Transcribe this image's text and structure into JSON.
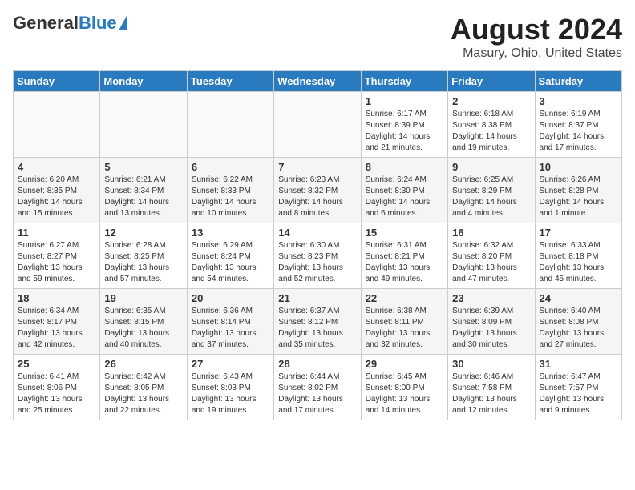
{
  "header": {
    "logo_general": "General",
    "logo_blue": "Blue",
    "title": "August 2024",
    "subtitle": "Masury, Ohio, United States"
  },
  "days_of_week": [
    "Sunday",
    "Monday",
    "Tuesday",
    "Wednesday",
    "Thursday",
    "Friday",
    "Saturday"
  ],
  "weeks": [
    [
      {
        "day": "",
        "info": ""
      },
      {
        "day": "",
        "info": ""
      },
      {
        "day": "",
        "info": ""
      },
      {
        "day": "",
        "info": ""
      },
      {
        "day": "1",
        "info": "Sunrise: 6:17 AM\nSunset: 8:39 PM\nDaylight: 14 hours\nand 21 minutes."
      },
      {
        "day": "2",
        "info": "Sunrise: 6:18 AM\nSunset: 8:38 PM\nDaylight: 14 hours\nand 19 minutes."
      },
      {
        "day": "3",
        "info": "Sunrise: 6:19 AM\nSunset: 8:37 PM\nDaylight: 14 hours\nand 17 minutes."
      }
    ],
    [
      {
        "day": "4",
        "info": "Sunrise: 6:20 AM\nSunset: 8:35 PM\nDaylight: 14 hours\nand 15 minutes."
      },
      {
        "day": "5",
        "info": "Sunrise: 6:21 AM\nSunset: 8:34 PM\nDaylight: 14 hours\nand 13 minutes."
      },
      {
        "day": "6",
        "info": "Sunrise: 6:22 AM\nSunset: 8:33 PM\nDaylight: 14 hours\nand 10 minutes."
      },
      {
        "day": "7",
        "info": "Sunrise: 6:23 AM\nSunset: 8:32 PM\nDaylight: 14 hours\nand 8 minutes."
      },
      {
        "day": "8",
        "info": "Sunrise: 6:24 AM\nSunset: 8:30 PM\nDaylight: 14 hours\nand 6 minutes."
      },
      {
        "day": "9",
        "info": "Sunrise: 6:25 AM\nSunset: 8:29 PM\nDaylight: 14 hours\nand 4 minutes."
      },
      {
        "day": "10",
        "info": "Sunrise: 6:26 AM\nSunset: 8:28 PM\nDaylight: 14 hours\nand 1 minute."
      }
    ],
    [
      {
        "day": "11",
        "info": "Sunrise: 6:27 AM\nSunset: 8:27 PM\nDaylight: 13 hours\nand 59 minutes."
      },
      {
        "day": "12",
        "info": "Sunrise: 6:28 AM\nSunset: 8:25 PM\nDaylight: 13 hours\nand 57 minutes."
      },
      {
        "day": "13",
        "info": "Sunrise: 6:29 AM\nSunset: 8:24 PM\nDaylight: 13 hours\nand 54 minutes."
      },
      {
        "day": "14",
        "info": "Sunrise: 6:30 AM\nSunset: 8:23 PM\nDaylight: 13 hours\nand 52 minutes."
      },
      {
        "day": "15",
        "info": "Sunrise: 6:31 AM\nSunset: 8:21 PM\nDaylight: 13 hours\nand 49 minutes."
      },
      {
        "day": "16",
        "info": "Sunrise: 6:32 AM\nSunset: 8:20 PM\nDaylight: 13 hours\nand 47 minutes."
      },
      {
        "day": "17",
        "info": "Sunrise: 6:33 AM\nSunset: 8:18 PM\nDaylight: 13 hours\nand 45 minutes."
      }
    ],
    [
      {
        "day": "18",
        "info": "Sunrise: 6:34 AM\nSunset: 8:17 PM\nDaylight: 13 hours\nand 42 minutes."
      },
      {
        "day": "19",
        "info": "Sunrise: 6:35 AM\nSunset: 8:15 PM\nDaylight: 13 hours\nand 40 minutes."
      },
      {
        "day": "20",
        "info": "Sunrise: 6:36 AM\nSunset: 8:14 PM\nDaylight: 13 hours\nand 37 minutes."
      },
      {
        "day": "21",
        "info": "Sunrise: 6:37 AM\nSunset: 8:12 PM\nDaylight: 13 hours\nand 35 minutes."
      },
      {
        "day": "22",
        "info": "Sunrise: 6:38 AM\nSunset: 8:11 PM\nDaylight: 13 hours\nand 32 minutes."
      },
      {
        "day": "23",
        "info": "Sunrise: 6:39 AM\nSunset: 8:09 PM\nDaylight: 13 hours\nand 30 minutes."
      },
      {
        "day": "24",
        "info": "Sunrise: 6:40 AM\nSunset: 8:08 PM\nDaylight: 13 hours\nand 27 minutes."
      }
    ],
    [
      {
        "day": "25",
        "info": "Sunrise: 6:41 AM\nSunset: 8:06 PM\nDaylight: 13 hours\nand 25 minutes."
      },
      {
        "day": "26",
        "info": "Sunrise: 6:42 AM\nSunset: 8:05 PM\nDaylight: 13 hours\nand 22 minutes."
      },
      {
        "day": "27",
        "info": "Sunrise: 6:43 AM\nSunset: 8:03 PM\nDaylight: 13 hours\nand 19 minutes."
      },
      {
        "day": "28",
        "info": "Sunrise: 6:44 AM\nSunset: 8:02 PM\nDaylight: 13 hours\nand 17 minutes."
      },
      {
        "day": "29",
        "info": "Sunrise: 6:45 AM\nSunset: 8:00 PM\nDaylight: 13 hours\nand 14 minutes."
      },
      {
        "day": "30",
        "info": "Sunrise: 6:46 AM\nSunset: 7:58 PM\nDaylight: 13 hours\nand 12 minutes."
      },
      {
        "day": "31",
        "info": "Sunrise: 6:47 AM\nSunset: 7:57 PM\nDaylight: 13 hours\nand 9 minutes."
      }
    ]
  ]
}
